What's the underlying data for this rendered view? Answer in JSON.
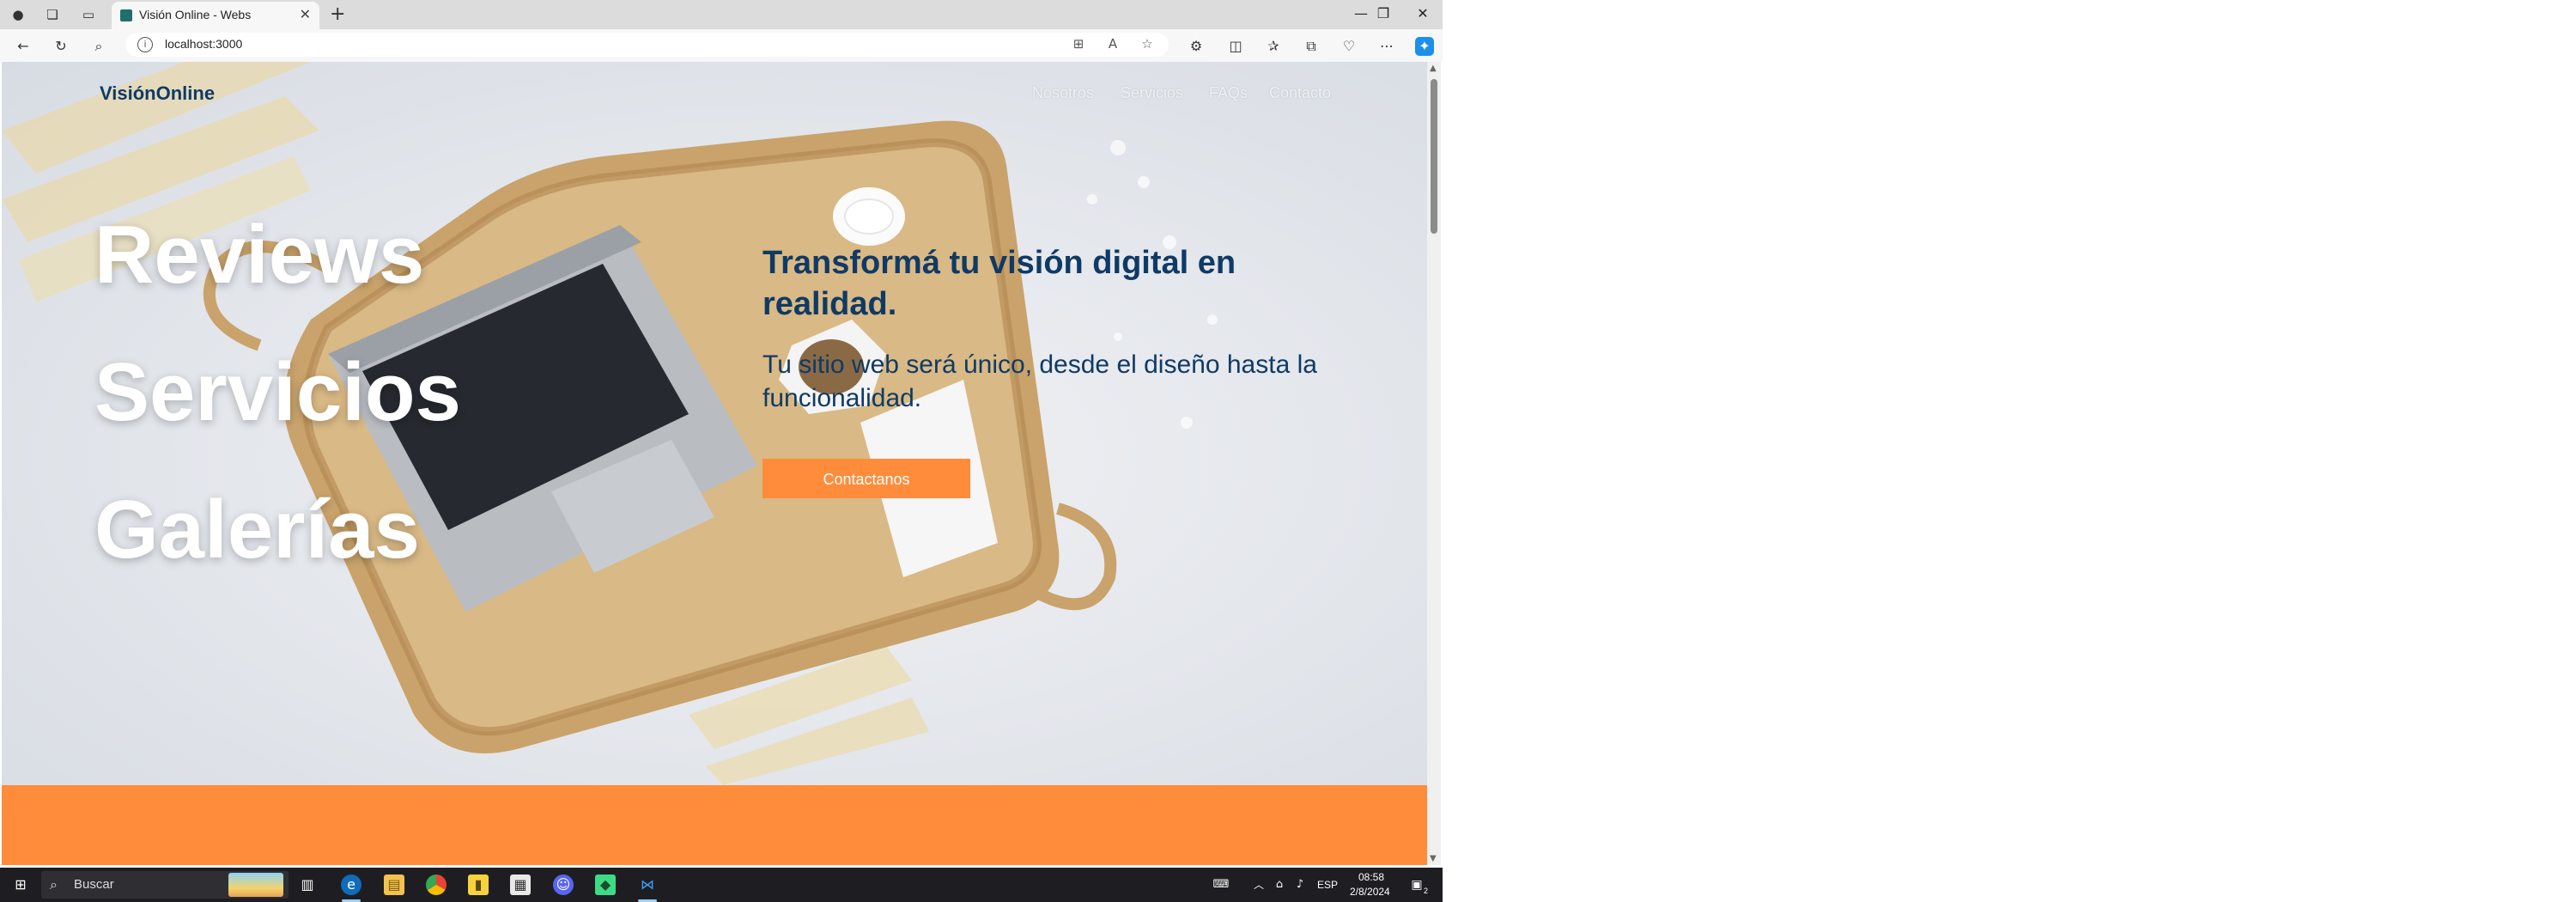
{
  "browser": {
    "tab_title": "Visión Online - Webs",
    "tab_close": "✕",
    "new_tab": "+",
    "url": "localhost:3000",
    "window_controls": [
      "—",
      "❐",
      "✕"
    ]
  },
  "site": {
    "brand": "VisiónOnline",
    "nav": [
      "Nosotros",
      "Servicios",
      "FAQs",
      "Contacto"
    ],
    "big_words": [
      "Reviews",
      "Servicios",
      "Galerías"
    ],
    "headline": "Transformá tu visión digital en realidad.",
    "subline": "Tu sitio web será único, desde el diseño hasta la funcionalidad.",
    "cta": "Contactanos",
    "colors": {
      "brand_blue": "#0f3a66",
      "accent_orange": "#ff8c3b"
    }
  },
  "taskbar": {
    "search_placeholder": "Buscar",
    "language": "ESP",
    "time": "08:58",
    "date": "2/8/2024",
    "notification_count": "2"
  },
  "icons": [
    "profile-icon",
    "workspaces-icon",
    "tab-actions-icon",
    "back-icon",
    "refresh-icon",
    "search-icon",
    "info-icon",
    "apps-icon",
    "read-aloud-icon",
    "favorite-icon",
    "extensions-icon",
    "split-screen-icon",
    "favorites-icon",
    "collections-icon",
    "browser-essentials-icon",
    "more-icon",
    "copilot-icon",
    "windows-start-icon",
    "task-view-icon",
    "edge-icon",
    "file-explorer-icon",
    "chrome-icon",
    "sticky-notes-icon",
    "calendar-icon",
    "discord-icon",
    "android-icon",
    "vscode-icon"
  ]
}
